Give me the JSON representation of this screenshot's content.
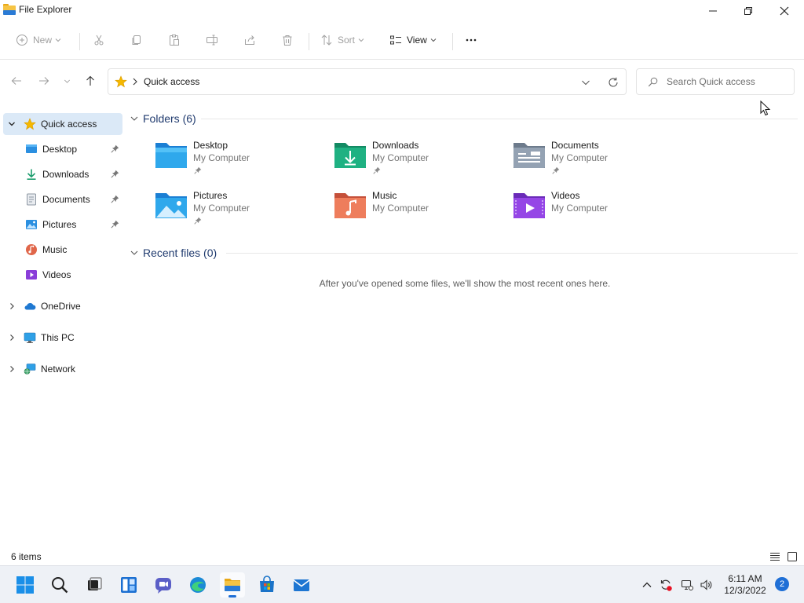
{
  "window": {
    "title": "File Explorer"
  },
  "toolbar": {
    "new_label": "New",
    "sort_label": "Sort",
    "view_label": "View"
  },
  "address": {
    "breadcrumb": "Quick access"
  },
  "search": {
    "placeholder": "Search Quick access"
  },
  "nav": {
    "quick_access": "Quick access",
    "pinned": [
      {
        "label": "Desktop",
        "icon": "desktop-icon"
      },
      {
        "label": "Downloads",
        "icon": "download-icon"
      },
      {
        "label": "Documents",
        "icon": "documents-icon"
      },
      {
        "label": "Pictures",
        "icon": "pictures-icon"
      },
      {
        "label": "Music",
        "icon": "music-icon"
      },
      {
        "label": "Videos",
        "icon": "videos-icon"
      }
    ],
    "onedrive": "OneDrive",
    "this_pc": "This PC",
    "network": "Network"
  },
  "content": {
    "folders_header": "Folders (6)",
    "folders": [
      {
        "name": "Desktop",
        "location": "My Computer"
      },
      {
        "name": "Downloads",
        "location": "My Computer"
      },
      {
        "name": "Documents",
        "location": "My Computer"
      },
      {
        "name": "Pictures",
        "location": "My Computer"
      },
      {
        "name": "Music",
        "location": "My Computer"
      },
      {
        "name": "Videos",
        "location": "My Computer"
      }
    ],
    "recent_header": "Recent files (0)",
    "recent_empty": "After you've opened some files, we'll show the most recent ones here."
  },
  "status": {
    "item_count": "6 items"
  },
  "taskbar": {
    "time": "6:11 AM",
    "date": "12/3/2022",
    "notification_count": "2"
  },
  "colors": {
    "accent": "#1f6fd6",
    "selected_nav": "#dbe9f7",
    "section_header": "#1f3a6e"
  }
}
